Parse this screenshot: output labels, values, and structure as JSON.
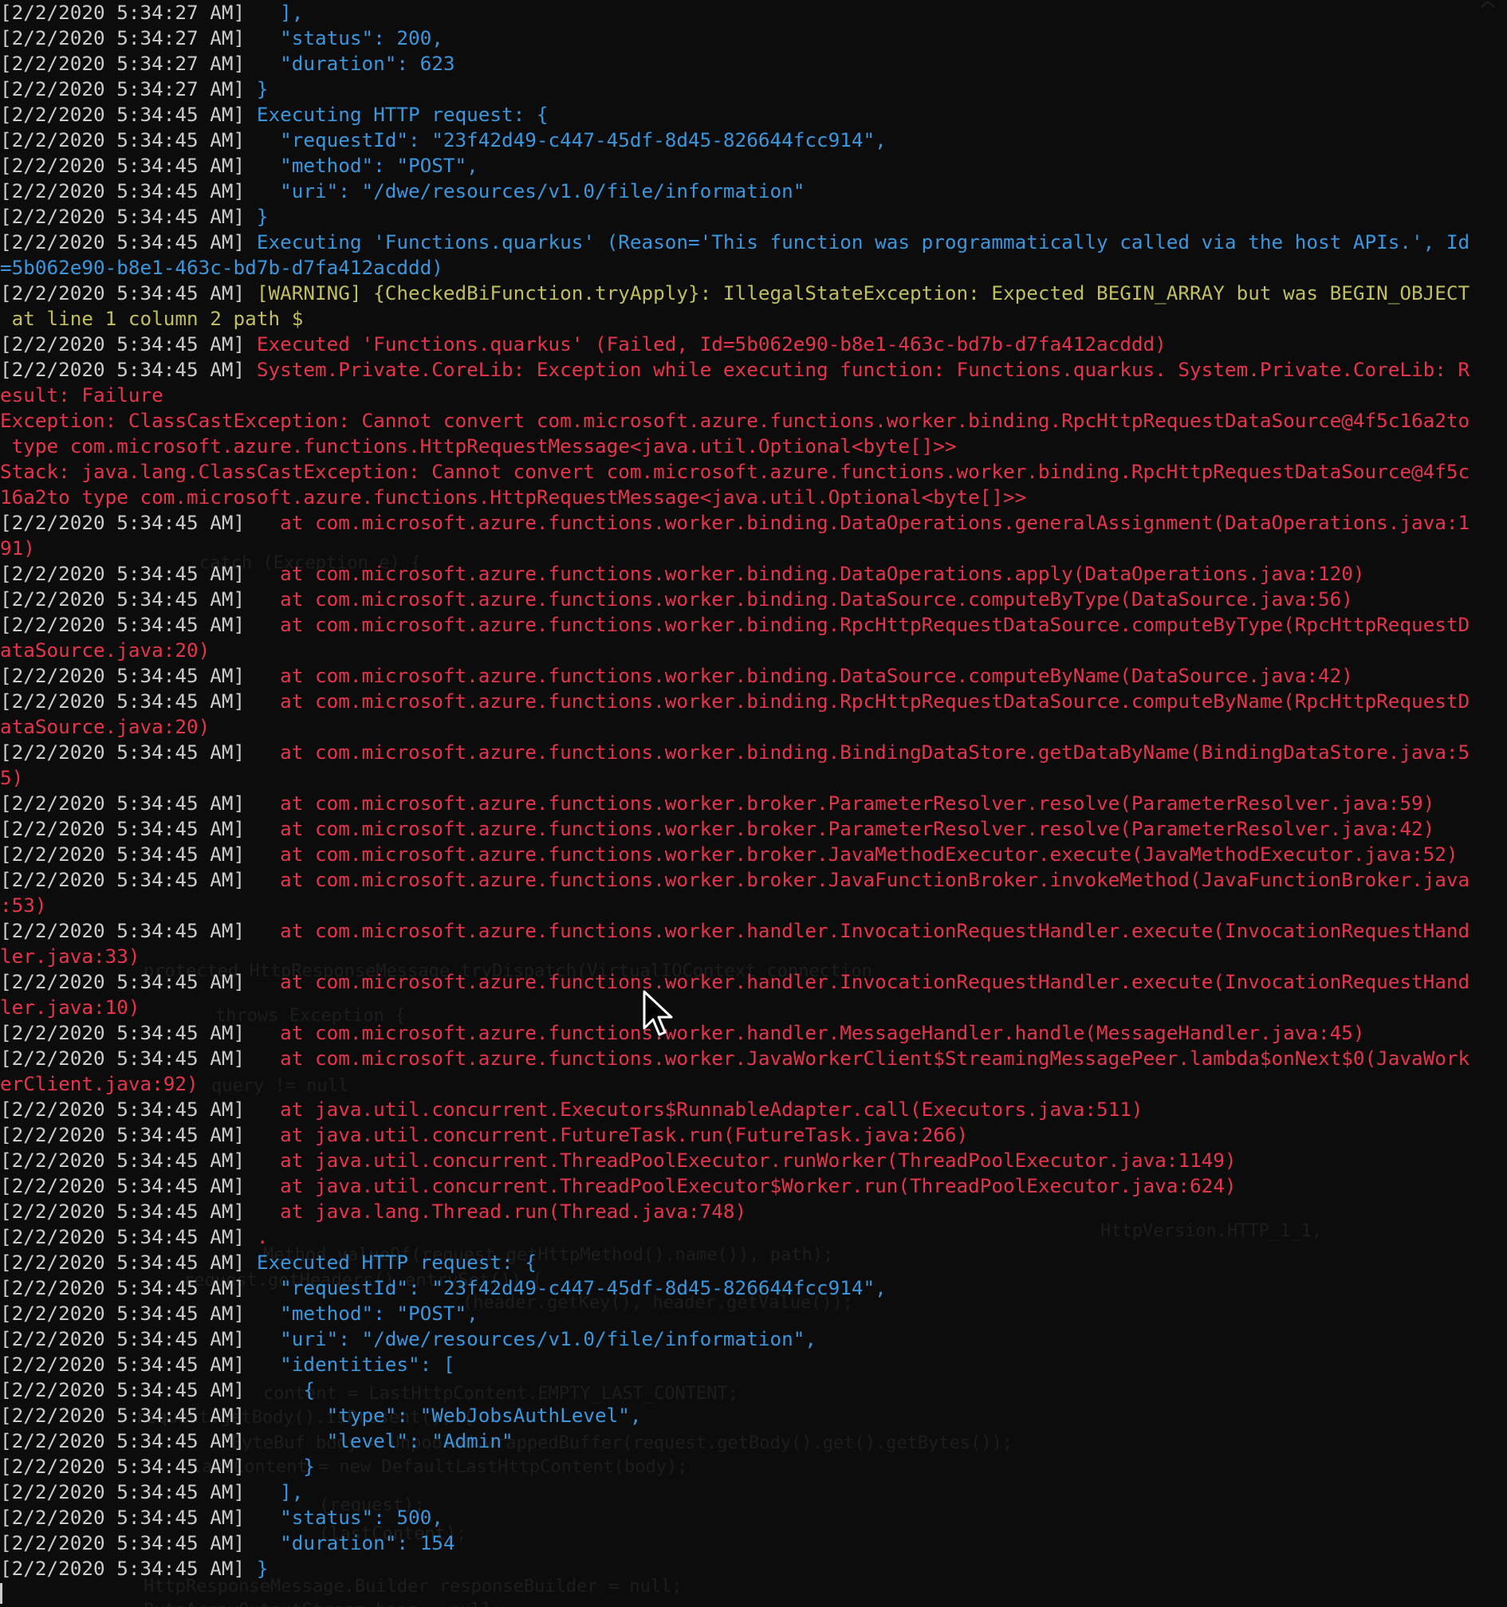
{
  "terminal": {
    "colors": {
      "background": "#0c0c0c",
      "timestamp": "#cccccc",
      "info": "#3a96dd",
      "warning": "#c1be5f",
      "error": "#e5344b"
    },
    "lines": [
      {
        "ts": "[2/2/2020 5:34:27 AM]",
        "text": "   ],",
        "style": "info"
      },
      {
        "ts": "[2/2/2020 5:34:27 AM]",
        "text": "   \"status\": 200,",
        "style": "info"
      },
      {
        "ts": "[2/2/2020 5:34:27 AM]",
        "text": "   \"duration\": 623",
        "style": "info"
      },
      {
        "ts": "[2/2/2020 5:34:27 AM]",
        "text": " }",
        "style": "info"
      },
      {
        "ts": "[2/2/2020 5:34:45 AM]",
        "text": " Executing HTTP request: {",
        "style": "info"
      },
      {
        "ts": "[2/2/2020 5:34:45 AM]",
        "text": "   \"requestId\": \"23f42d49-c447-45df-8d45-826644fcc914\",",
        "style": "info"
      },
      {
        "ts": "[2/2/2020 5:34:45 AM]",
        "text": "   \"method\": \"POST\",",
        "style": "info"
      },
      {
        "ts": "[2/2/2020 5:34:45 AM]",
        "text": "   \"uri\": \"/dwe/resources/v1.0/file/information\"",
        "style": "info"
      },
      {
        "ts": "[2/2/2020 5:34:45 AM]",
        "text": " }",
        "style": "info"
      },
      {
        "ts": "[2/2/2020 5:34:45 AM]",
        "text": " Executing 'Functions.quarkus' (Reason='This function was programmatically called via the host APIs.', Id",
        "style": "info"
      },
      {
        "ts": "",
        "text": "=5b062e90-b8e1-463c-bd7b-d7fa412acddd)",
        "style": "info"
      },
      {
        "ts": "[2/2/2020 5:34:45 AM]",
        "text": " [WARNING] {CheckedBiFunction.tryApply}: IllegalStateException: Expected BEGIN_ARRAY but was BEGIN_OBJECT",
        "style": "warn"
      },
      {
        "ts": "",
        "text": " at line 1 column 2 path $",
        "style": "warn"
      },
      {
        "ts": "[2/2/2020 5:34:45 AM]",
        "text": " Executed 'Functions.quarkus' (Failed, Id=5b062e90-b8e1-463c-bd7b-d7fa412acddd)",
        "style": "err"
      },
      {
        "ts": "[2/2/2020 5:34:45 AM]",
        "text": " System.Private.CoreLib: Exception while executing function: Functions.quarkus. System.Private.CoreLib: R",
        "style": "err"
      },
      {
        "ts": "",
        "text": "esult: Failure",
        "style": "err"
      },
      {
        "ts": "",
        "text": "Exception: ClassCastException: Cannot convert com.microsoft.azure.functions.worker.binding.RpcHttpRequestDataSource@4f5c16a2to",
        "style": "err"
      },
      {
        "ts": "",
        "text": " type com.microsoft.azure.functions.HttpRequestMessage<java.util.Optional<byte[]>>",
        "style": "err"
      },
      {
        "ts": "",
        "text": "Stack: java.lang.ClassCastException: Cannot convert com.microsoft.azure.functions.worker.binding.RpcHttpRequestDataSource@4f5c",
        "style": "err"
      },
      {
        "ts": "",
        "text": "16a2to type com.microsoft.azure.functions.HttpRequestMessage<java.util.Optional<byte[]>>",
        "style": "err"
      },
      {
        "ts": "[2/2/2020 5:34:45 AM]",
        "text": "   at com.microsoft.azure.functions.worker.binding.DataOperations.generalAssignment(DataOperations.java:1",
        "style": "err"
      },
      {
        "ts": "",
        "text": "91)",
        "style": "err"
      },
      {
        "ts": "[2/2/2020 5:34:45 AM]",
        "text": "   at com.microsoft.azure.functions.worker.binding.DataOperations.apply(DataOperations.java:120)",
        "style": "err"
      },
      {
        "ts": "[2/2/2020 5:34:45 AM]",
        "text": "   at com.microsoft.azure.functions.worker.binding.DataSource.computeByType(DataSource.java:56)",
        "style": "err"
      },
      {
        "ts": "[2/2/2020 5:34:45 AM]",
        "text": "   at com.microsoft.azure.functions.worker.binding.RpcHttpRequestDataSource.computeByType(RpcHttpRequestD",
        "style": "err"
      },
      {
        "ts": "",
        "text": "ataSource.java:20)",
        "style": "err"
      },
      {
        "ts": "[2/2/2020 5:34:45 AM]",
        "text": "   at com.microsoft.azure.functions.worker.binding.DataSource.computeByName(DataSource.java:42)",
        "style": "err"
      },
      {
        "ts": "[2/2/2020 5:34:45 AM]",
        "text": "   at com.microsoft.azure.functions.worker.binding.RpcHttpRequestDataSource.computeByName(RpcHttpRequestD",
        "style": "err"
      },
      {
        "ts": "",
        "text": "ataSource.java:20)",
        "style": "err"
      },
      {
        "ts": "[2/2/2020 5:34:45 AM]",
        "text": "   at com.microsoft.azure.functions.worker.binding.BindingDataStore.getDataByName(BindingDataStore.java:5",
        "style": "err"
      },
      {
        "ts": "",
        "text": "5)",
        "style": "err"
      },
      {
        "ts": "[2/2/2020 5:34:45 AM]",
        "text": "   at com.microsoft.azure.functions.worker.broker.ParameterResolver.resolve(ParameterResolver.java:59)",
        "style": "err"
      },
      {
        "ts": "[2/2/2020 5:34:45 AM]",
        "text": "   at com.microsoft.azure.functions.worker.broker.ParameterResolver.resolve(ParameterResolver.java:42)",
        "style": "err"
      },
      {
        "ts": "[2/2/2020 5:34:45 AM]",
        "text": "   at com.microsoft.azure.functions.worker.broker.JavaMethodExecutor.execute(JavaMethodExecutor.java:52)",
        "style": "err"
      },
      {
        "ts": "[2/2/2020 5:34:45 AM]",
        "text": "   at com.microsoft.azure.functions.worker.broker.JavaFunctionBroker.invokeMethod(JavaFunctionBroker.java",
        "style": "err"
      },
      {
        "ts": "",
        "text": ":53)",
        "style": "err"
      },
      {
        "ts": "[2/2/2020 5:34:45 AM]",
        "text": "   at com.microsoft.azure.functions.worker.handler.InvocationRequestHandler.execute(InvocationRequestHand",
        "style": "err"
      },
      {
        "ts": "",
        "text": "ler.java:33)",
        "style": "err"
      },
      {
        "ts": "[2/2/2020 5:34:45 AM]",
        "text": "   at com.microsoft.azure.functions.worker.handler.InvocationRequestHandler.execute(InvocationRequestHand",
        "style": "err"
      },
      {
        "ts": "",
        "text": "ler.java:10)",
        "style": "err"
      },
      {
        "ts": "[2/2/2020 5:34:45 AM]",
        "text": "   at com.microsoft.azure.functions.worker.handler.MessageHandler.handle(MessageHandler.java:45)",
        "style": "err"
      },
      {
        "ts": "[2/2/2020 5:34:45 AM]",
        "text": "   at com.microsoft.azure.functions.worker.JavaWorkerClient$StreamingMessagePeer.lambda$onNext$0(JavaWork",
        "style": "err"
      },
      {
        "ts": "",
        "text": "erClient.java:92)",
        "style": "err"
      },
      {
        "ts": "[2/2/2020 5:34:45 AM]",
        "text": "   at java.util.concurrent.Executors$RunnableAdapter.call(Executors.java:511)",
        "style": "err"
      },
      {
        "ts": "[2/2/2020 5:34:45 AM]",
        "text": "   at java.util.concurrent.FutureTask.run(FutureTask.java:266)",
        "style": "err"
      },
      {
        "ts": "[2/2/2020 5:34:45 AM]",
        "text": "   at java.util.concurrent.ThreadPoolExecutor.runWorker(ThreadPoolExecutor.java:1149)",
        "style": "err"
      },
      {
        "ts": "[2/2/2020 5:34:45 AM]",
        "text": "   at java.util.concurrent.ThreadPoolExecutor$Worker.run(ThreadPoolExecutor.java:624)",
        "style": "err"
      },
      {
        "ts": "[2/2/2020 5:34:45 AM]",
        "text": "   at java.lang.Thread.run(Thread.java:748)",
        "style": "err"
      },
      {
        "ts": "[2/2/2020 5:34:45 AM]",
        "text": " .",
        "style": "err"
      },
      {
        "ts": "[2/2/2020 5:34:45 AM]",
        "text": " Executed HTTP request: {",
        "style": "info"
      },
      {
        "ts": "[2/2/2020 5:34:45 AM]",
        "text": "   \"requestId\": \"23f42d49-c447-45df-8d45-826644fcc914\",",
        "style": "info"
      },
      {
        "ts": "[2/2/2020 5:34:45 AM]",
        "text": "   \"method\": \"POST\",",
        "style": "info"
      },
      {
        "ts": "[2/2/2020 5:34:45 AM]",
        "text": "   \"uri\": \"/dwe/resources/v1.0/file/information\",",
        "style": "info"
      },
      {
        "ts": "[2/2/2020 5:34:45 AM]",
        "text": "   \"identities\": [",
        "style": "info"
      },
      {
        "ts": "[2/2/2020 5:34:45 AM]",
        "text": "     {",
        "style": "info"
      },
      {
        "ts": "[2/2/2020 5:34:45 AM]",
        "text": "       \"type\": \"WebJobsAuthLevel\",",
        "style": "info"
      },
      {
        "ts": "[2/2/2020 5:34:45 AM]",
        "text": "       \"level\": \"Admin\"",
        "style": "info"
      },
      {
        "ts": "[2/2/2020 5:34:45 AM]",
        "text": "     }",
        "style": "info"
      },
      {
        "ts": "[2/2/2020 5:34:45 AM]",
        "text": "   ],",
        "style": "info"
      },
      {
        "ts": "[2/2/2020 5:34:45 AM]",
        "text": "   \"status\": 500,",
        "style": "info"
      },
      {
        "ts": "[2/2/2020 5:34:45 AM]",
        "text": "   \"duration\": 154",
        "style": "info"
      },
      {
        "ts": "[2/2/2020 5:34:45 AM]",
        "text": " }",
        "style": "info"
      }
    ]
  },
  "background_ghost": {
    "lines": [
      "catch (Exception e) {",
      "protected HttpResponseMessage tryDispatch(VirtualIOContext connection",
      "throws Exception {",
      "query != null",
      "HttpVersion.HTTP_1_1,",
      "Method.valueOf(request.getHttpMethod().name()), path);",
      "request.getHeaders().entrySet()) {",
      "(header.getKey(), header.getValue());",
      "content = LastHttpContent.EMPTY_LAST_CONTENT;",
      "request.getBody().isPresent()) {",
      "ByteBuf body = Unpooled.wrappedBuffer(request.getBody().get().getBytes());",
      "lastContent = new DefaultLastHttpContent(body);",
      "(request);",
      "(lastContent);",
      "HttpResponseMessage.Builder responseBuilder = null;",
      "ByteArrayOutputStream baos = null;"
    ]
  },
  "icons": {
    "pointer": "mouse-pointer-icon",
    "scroll": "scroll-up-icon"
  }
}
